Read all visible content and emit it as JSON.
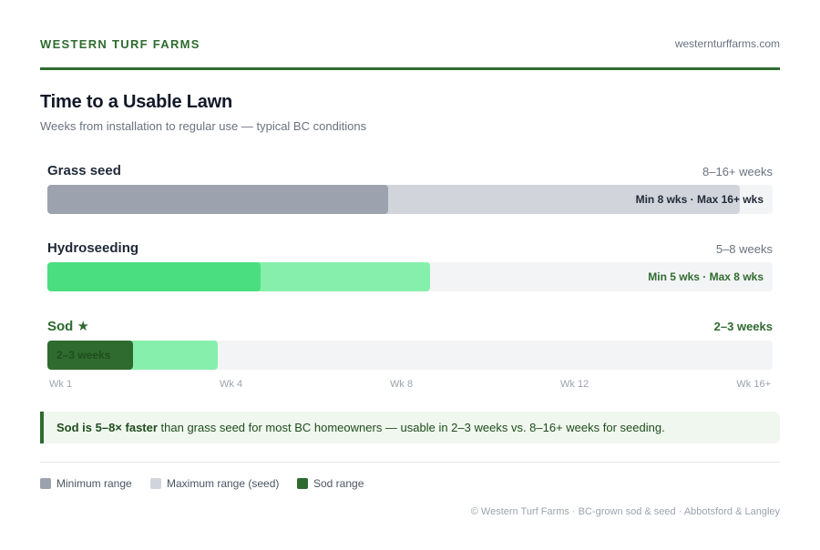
{
  "header": {
    "brand": "WESTERN TURF FARMS",
    "site": "westernturffarms.com"
  },
  "title": "Time to a Usable Lawn",
  "subtitle": "Weeks from installation to regular use — typical BC conditions",
  "chart_data": {
    "type": "bar",
    "orientation": "horizontal",
    "axis": {
      "min": 1,
      "max": 16,
      "ticks": [
        "Wk 1",
        "Wk 4",
        "Wk 8",
        "Wk 12",
        "Wk 16+"
      ]
    },
    "rows": [
      {
        "label": "Grass seed",
        "range_label": "8–16+ weeks",
        "min": 8,
        "max": 16,
        "bar_text": "Min 8 wks · Max 16+ wks",
        "min_color": "#9ca3af",
        "max_color": "#d1d5db",
        "accent": false
      },
      {
        "label": "Hydroseeding",
        "range_label": "5–8 weeks",
        "min": 5,
        "max": 8,
        "bar_text": "Min 5 wks · Max 8 wks",
        "min_color": "#4ade80",
        "max_color": "#86efac",
        "accent": false
      },
      {
        "label": "Sod ★",
        "range_label": "2–3 weeks",
        "min": 2,
        "max": 3,
        "bar_text": "2–3 weeks",
        "min_color": "#2f6b2f",
        "max_color": "#86efac",
        "accent": true
      }
    ]
  },
  "callout": {
    "strong": "Sod is 5–8× faster",
    "rest": " than grass seed for most BC homeowners — usable in 2–3 weeks vs. 8–16+ weeks for seeding."
  },
  "legend": [
    {
      "label": "Minimum range",
      "color": "#9ca3af"
    },
    {
      "label": "Maximum range (seed)",
      "color": "#d1d5db"
    },
    {
      "label": "Sod range",
      "color": "#2f6b2f"
    }
  ],
  "footer": "© Western Turf Farms · BC-grown sod & seed · Abbotsford & Langley"
}
